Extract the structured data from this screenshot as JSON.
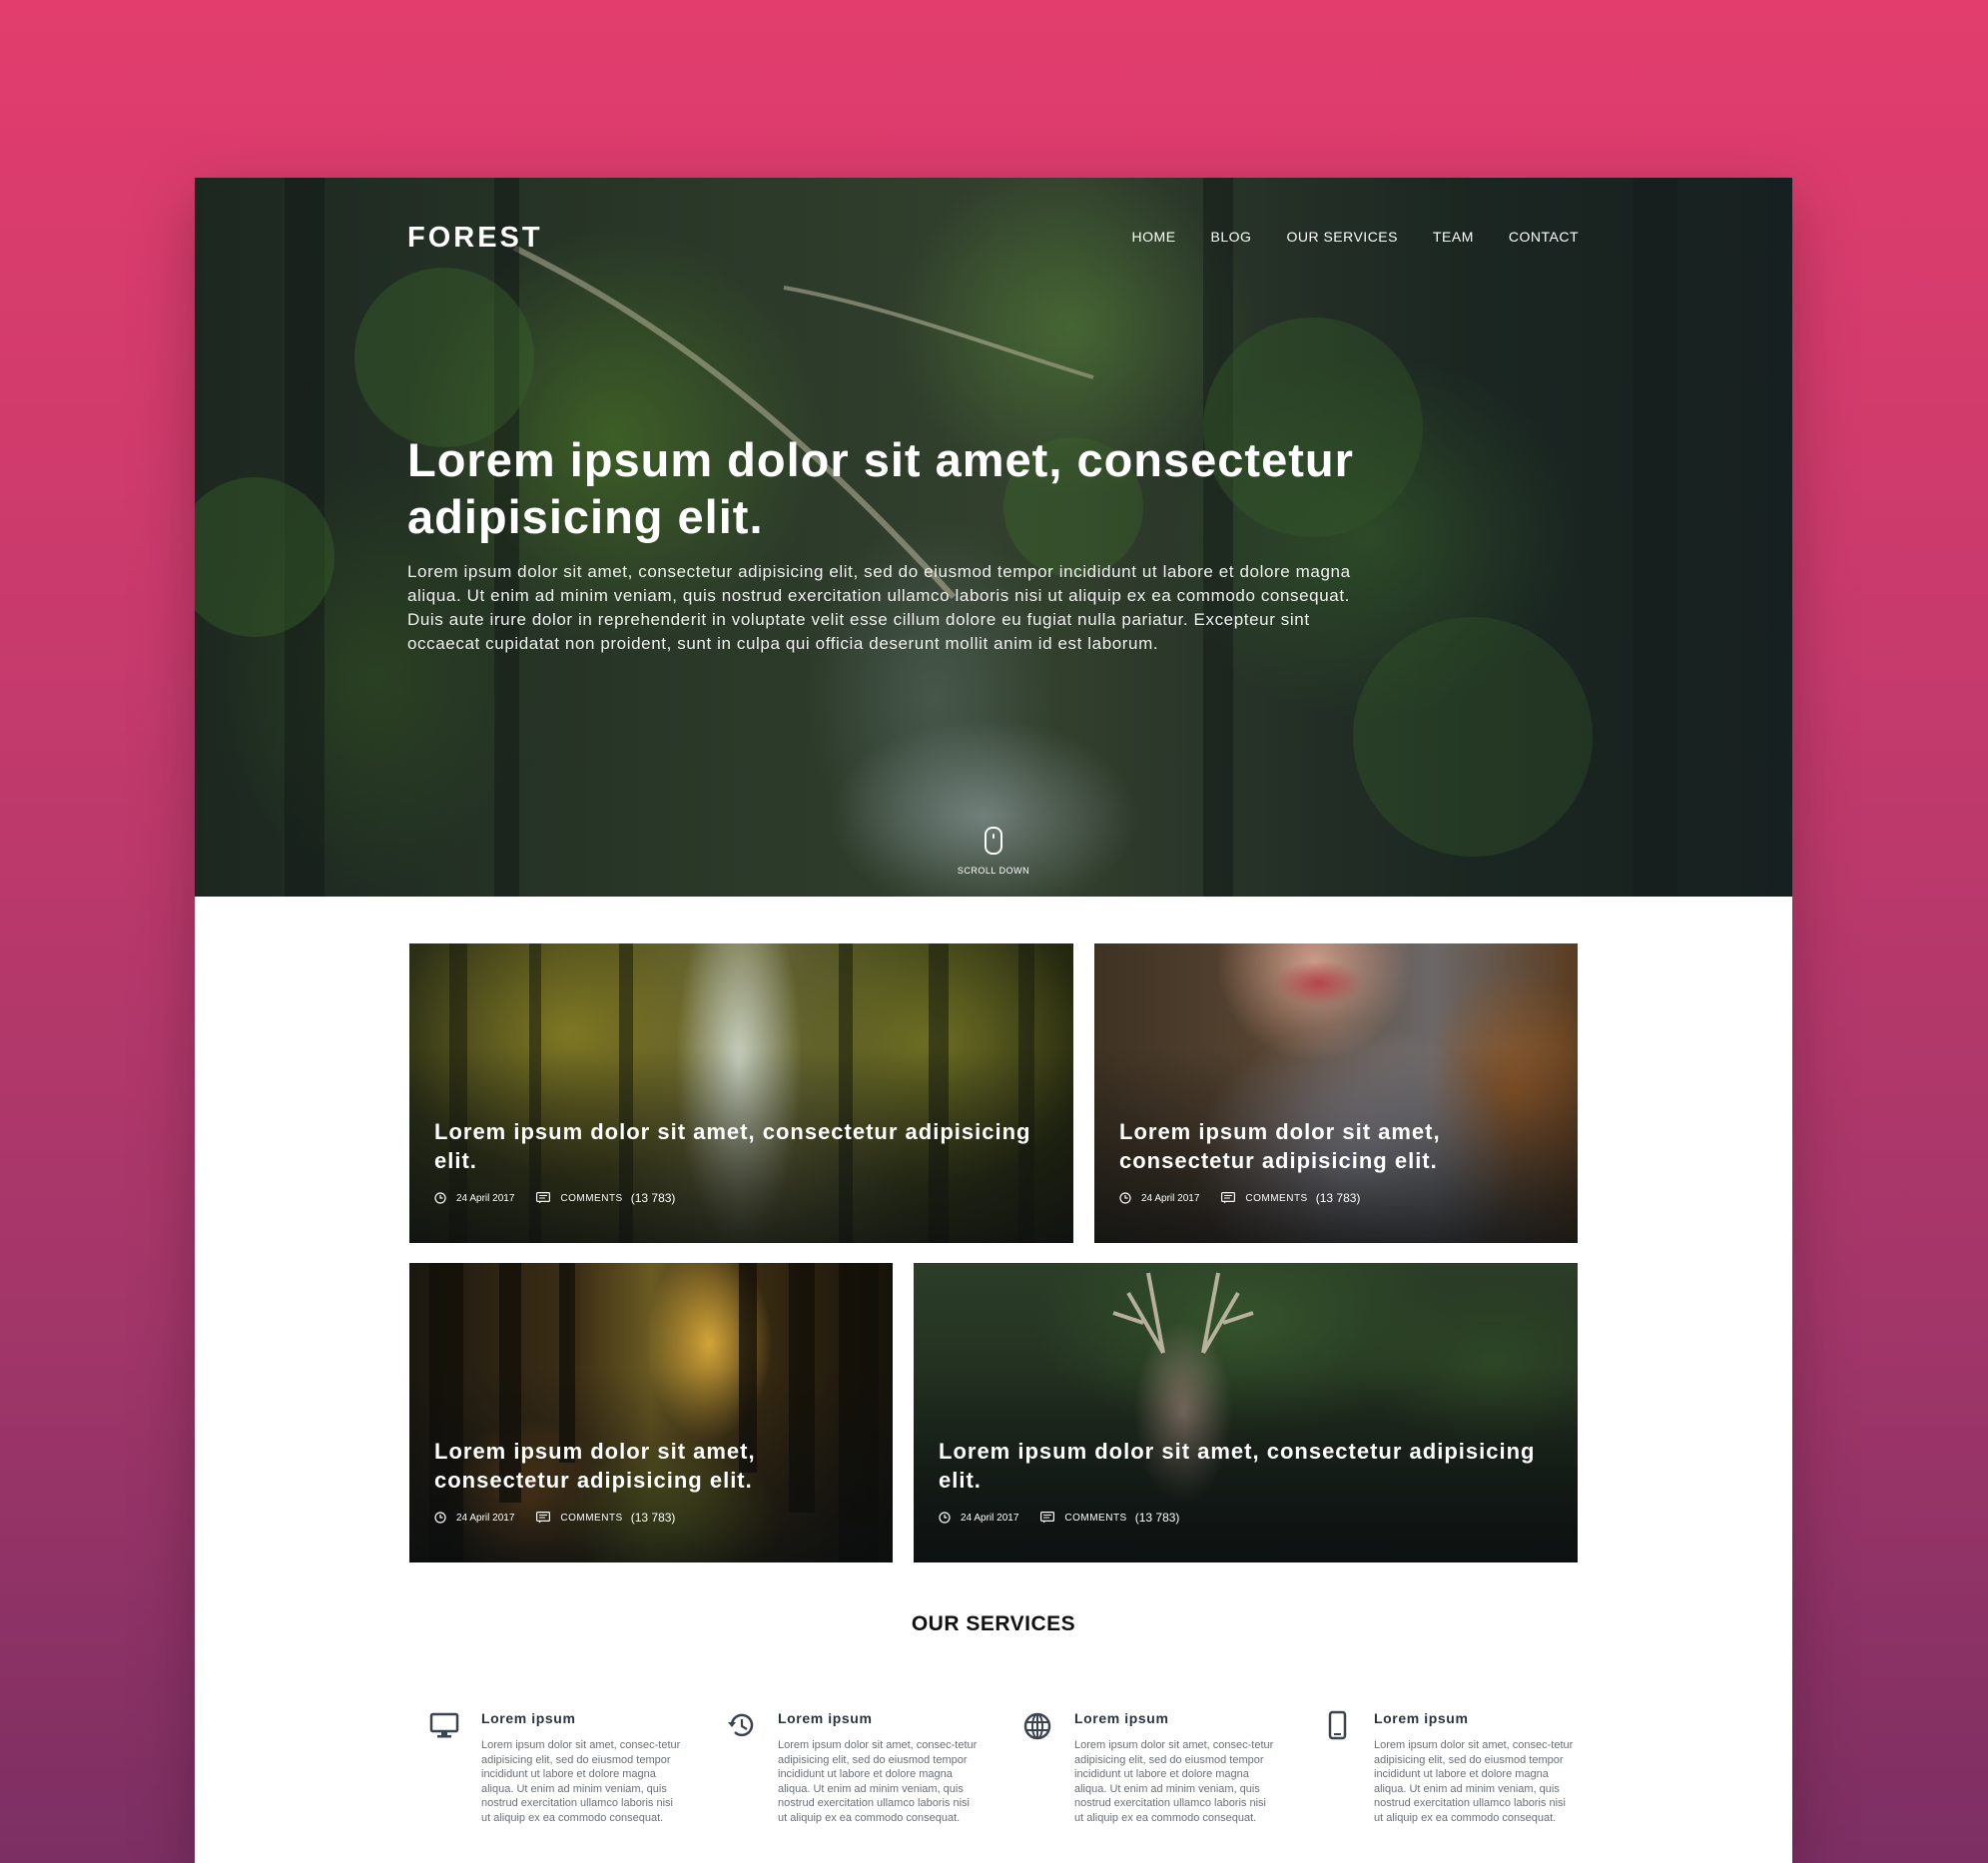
{
  "brand": "FOREST",
  "nav": [
    "HOME",
    "BLOG",
    "OUR SERVICES",
    "TEAM",
    "CONTACT"
  ],
  "hero": {
    "title": "Lorem ipsum dolor sit amet, consectetur adipisicing elit.",
    "text": "Lorem ipsum dolor sit amet, consectetur adipisicing elit, sed do eiusmod tempor incididunt ut labore et dolore magna aliqua. Ut enim ad minim veniam, quis nostrud exercitation ullamco laboris nisi ut aliquip ex ea commodo consequat. Duis aute irure dolor in reprehenderit in voluptate velit esse cillum dolore eu fugiat nulla pariatur. Excepteur sint occaecat cupidatat non proident, sunt in culpa qui officia deserunt mollit anim id est laborum.",
    "scroll_label": "SCROLL DOWN"
  },
  "posts": [
    {
      "title": "Lorem ipsum dolor sit amet, consectetur adipisicing elit.",
      "date": "24 April 2017",
      "comments_label": "COMMENTS",
      "comments_count": "(13 783)"
    },
    {
      "title": "Lorem ipsum dolor sit amet, consectetur adipisicing elit.",
      "date": "24 April 2017",
      "comments_label": "COMMENTS",
      "comments_count": "(13 783)"
    },
    {
      "title": "Lorem ipsum dolor sit amet, consectetur adipisicing elit.",
      "date": "24 April 2017",
      "comments_label": "COMMENTS",
      "comments_count": "(13 783)"
    },
    {
      "title": "Lorem ipsum dolor sit amet, consectetur adipisicing elit.",
      "date": "24 April 2017",
      "comments_label": "COMMENTS",
      "comments_count": "(13 783)"
    }
  ],
  "services": {
    "title": "OUR SERVICES",
    "items": [
      {
        "icon": "monitor-icon",
        "title": "Lorem ipsum",
        "text": "Lorem ipsum dolor sit amet, consec-tetur adipisicing elit, sed do eiusmod tempor incididunt ut labore et dolore magna aliqua. Ut enim ad minim veniam, quis nostrud exercitation ullamco laboris nisi ut aliquip ex ea commodo consequat."
      },
      {
        "icon": "history-icon",
        "title": "Lorem ipsum",
        "text": "Lorem ipsum dolor sit amet, consec-tetur adipisicing elit, sed do eiusmod tempor incididunt ut labore et dolore magna aliqua. Ut enim ad minim veniam, quis nostrud exercitation ullamco laboris nisi ut aliquip ex ea commodo consequat."
      },
      {
        "icon": "globe-icon",
        "title": "Lorem ipsum",
        "text": "Lorem ipsum dolor sit amet, consec-tetur adipisicing elit, sed do eiusmod tempor incididunt ut labore et dolore magna aliqua. Ut enim ad minim veniam, quis nostrud exercitation ullamco laboris nisi ut aliquip ex ea commodo consequat."
      },
      {
        "icon": "smartphone-icon",
        "title": "Lorem ipsum",
        "text": "Lorem ipsum dolor sit amet, consec-tetur adipisicing elit, sed do eiusmod tempor incididunt ut labore et dolore magna aliqua. Ut enim ad minim veniam, quis nostrud exercitation ullamco laboris nisi ut aliquip ex ea commodo consequat."
      }
    ]
  },
  "colors": {
    "accent_top": "#e23d6d",
    "accent_bottom": "#7c2f63",
    "icon": "#3a4350"
  }
}
